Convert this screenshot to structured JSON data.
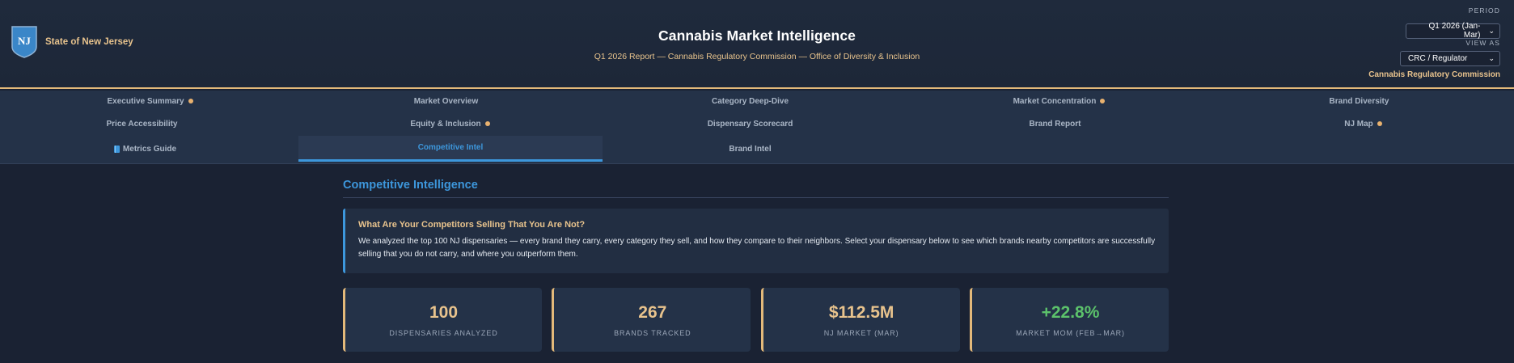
{
  "header": {
    "state_badge": "NJ",
    "state_name": "State of New Jersey",
    "title": "Cannabis Market Intelligence",
    "subtitle": "Q1 2026 Report — Cannabis Regulatory Commission — Office of Diversity & Inclusion",
    "period_label": "PERIOD",
    "period_value": "Q1 2026 (Jan-Mar)",
    "view_label": "VIEW AS",
    "view_value": "CRC / Regulator",
    "org_name": "Cannabis Regulatory Commission"
  },
  "nav": {
    "items": [
      {
        "label": "Executive Summary",
        "dot": true
      },
      {
        "label": "Market Overview",
        "dot": false
      },
      {
        "label": "Category Deep-Dive",
        "dot": false
      },
      {
        "label": "Market Concentration",
        "dot": true
      },
      {
        "label": "Brand Diversity",
        "dot": false
      },
      {
        "label": "Price Accessibility",
        "dot": false
      },
      {
        "label": "Equity & Inclusion",
        "dot": true
      },
      {
        "label": "Dispensary Scorecard",
        "dot": false
      },
      {
        "label": "Brand Report",
        "dot": false
      },
      {
        "label": "NJ Map",
        "dot": true
      },
      {
        "label": "Metrics Guide",
        "dot": false,
        "icon": "book-icon"
      },
      {
        "label": "Competitive Intel",
        "dot": false,
        "active": true
      },
      {
        "label": "Brand Intel",
        "dot": false
      }
    ]
  },
  "main": {
    "section_title": "Competitive Intelligence",
    "callout": {
      "title": "What Are Your Competitors Selling That You Are Not?",
      "body": "We analyzed the top 100 NJ dispensaries — every brand they carry, every category they sell, and how they compare to their neighbors. Select your dispensary below to see which brands nearby competitors are successfully selling that you do not carry, and where you outperform them."
    },
    "stats": [
      {
        "value": "100",
        "label": "DISPENSARIES ANALYZED"
      },
      {
        "value": "267",
        "label": "BRANDS TRACKED"
      },
      {
        "value": "$112.5M",
        "label": "NJ MARKET (MAR)"
      },
      {
        "value": "+22.8%",
        "label": "MARKET MOM (FEB→MAR)"
      }
    ]
  },
  "colors": {
    "accent_blue": "#3d97dc",
    "accent_gold": "#e8c38d",
    "positive_green": "#5cc26b",
    "background": "#1a2233"
  }
}
